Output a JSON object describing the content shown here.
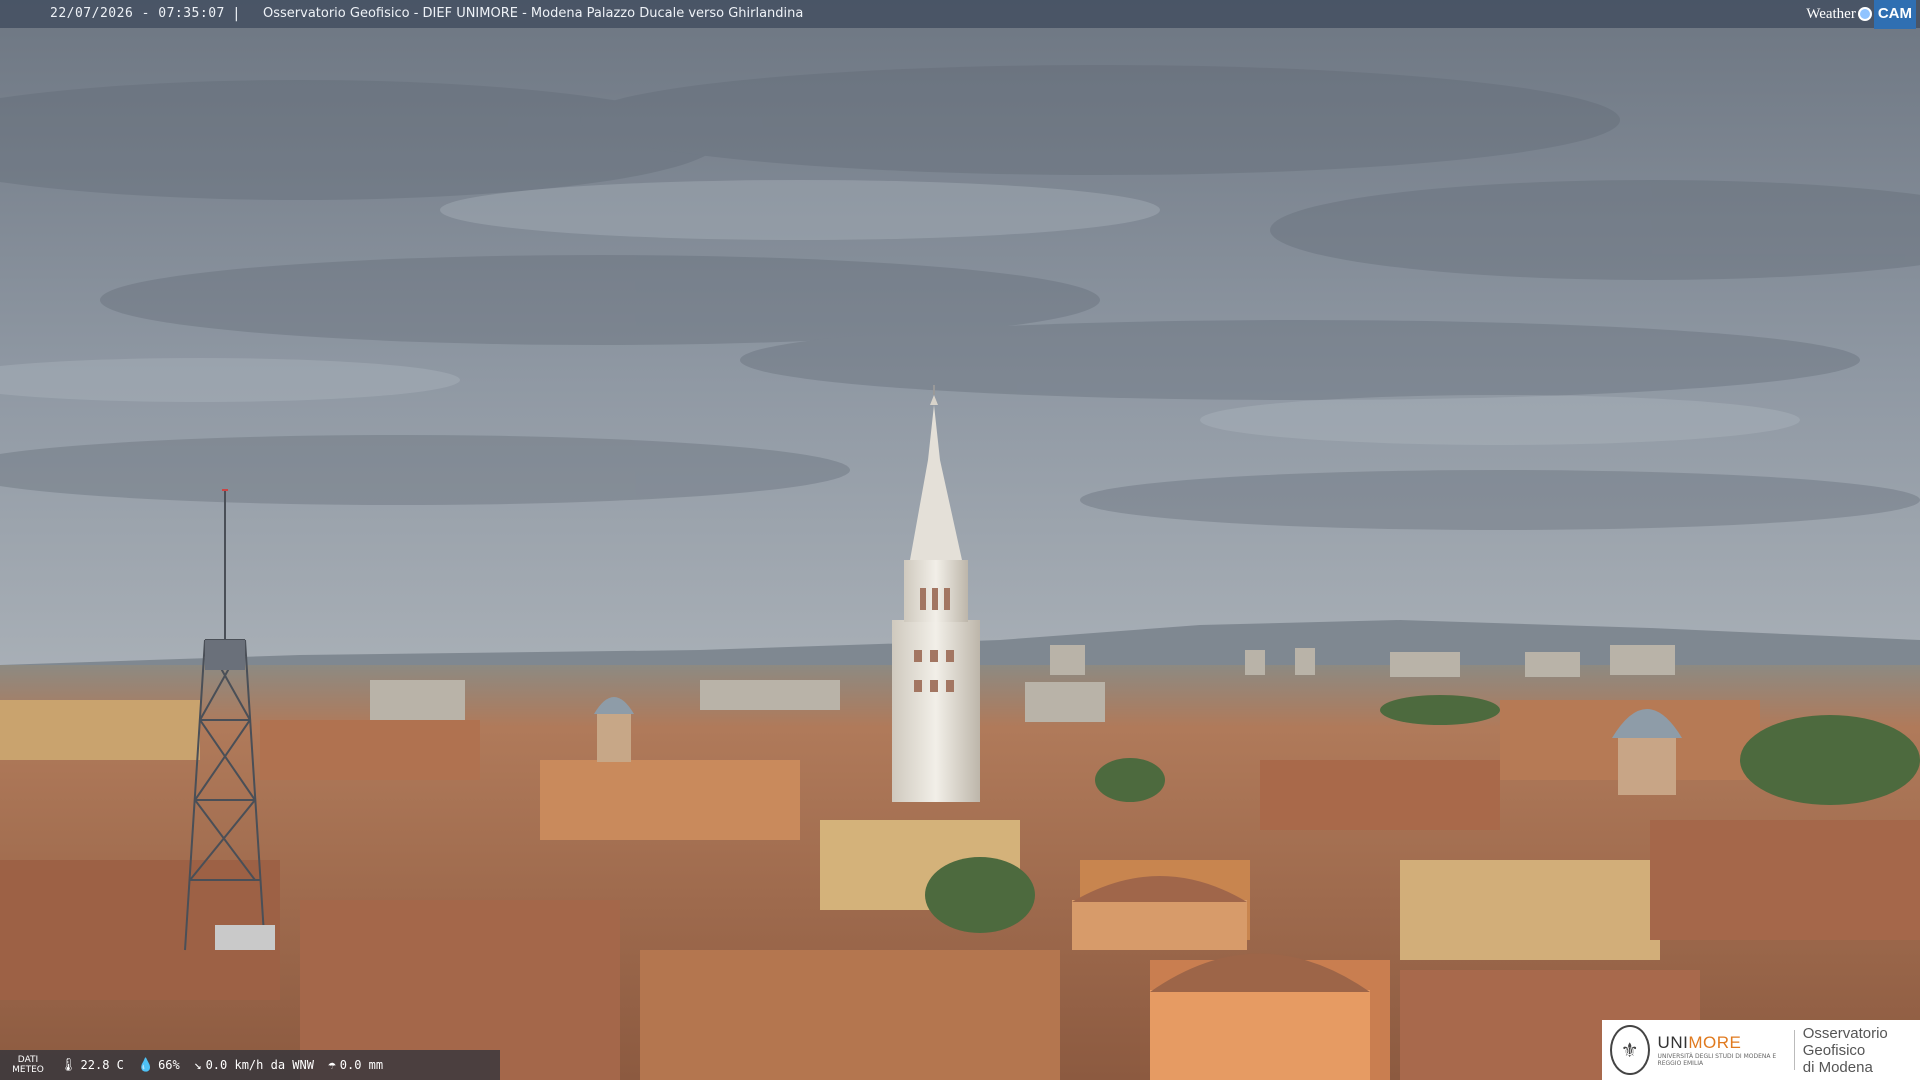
{
  "header": {
    "datetime": "22/07/2026 - 07:35:07",
    "separator": "|",
    "title": "Osservatorio Geofisico - DIEF UNIMORE - Modena Palazzo Ducale verso Ghirlandina",
    "brand_weather": "Weather",
    "brand_cam": "CAM"
  },
  "meteo": {
    "label_line1": "DATI",
    "label_line2": "METEO",
    "temperature": "22.8 C",
    "humidity": "66%",
    "wind": "0.0 km/h da WNW",
    "rain": "0.0 mm",
    "icons": [
      "thermometer-icon",
      "humidity-drop-icon",
      "wind-icon",
      "rain-icon"
    ]
  },
  "logo": {
    "uni_part1": "UNI",
    "uni_part2": "MORE",
    "uni_sub": "UNIVERSITÀ DEGLI STUDI DI MODENA E REGGIO EMILIA",
    "observatory_line1": "Osservatorio Geofisico",
    "observatory_line2": "di Modena"
  },
  "colors": {
    "sky_top": "#6f7884",
    "sky_bottom": "#9aa3ad",
    "roof": "#a8694a",
    "tower": "#e8e4dc",
    "accent": "#e07a1f"
  }
}
